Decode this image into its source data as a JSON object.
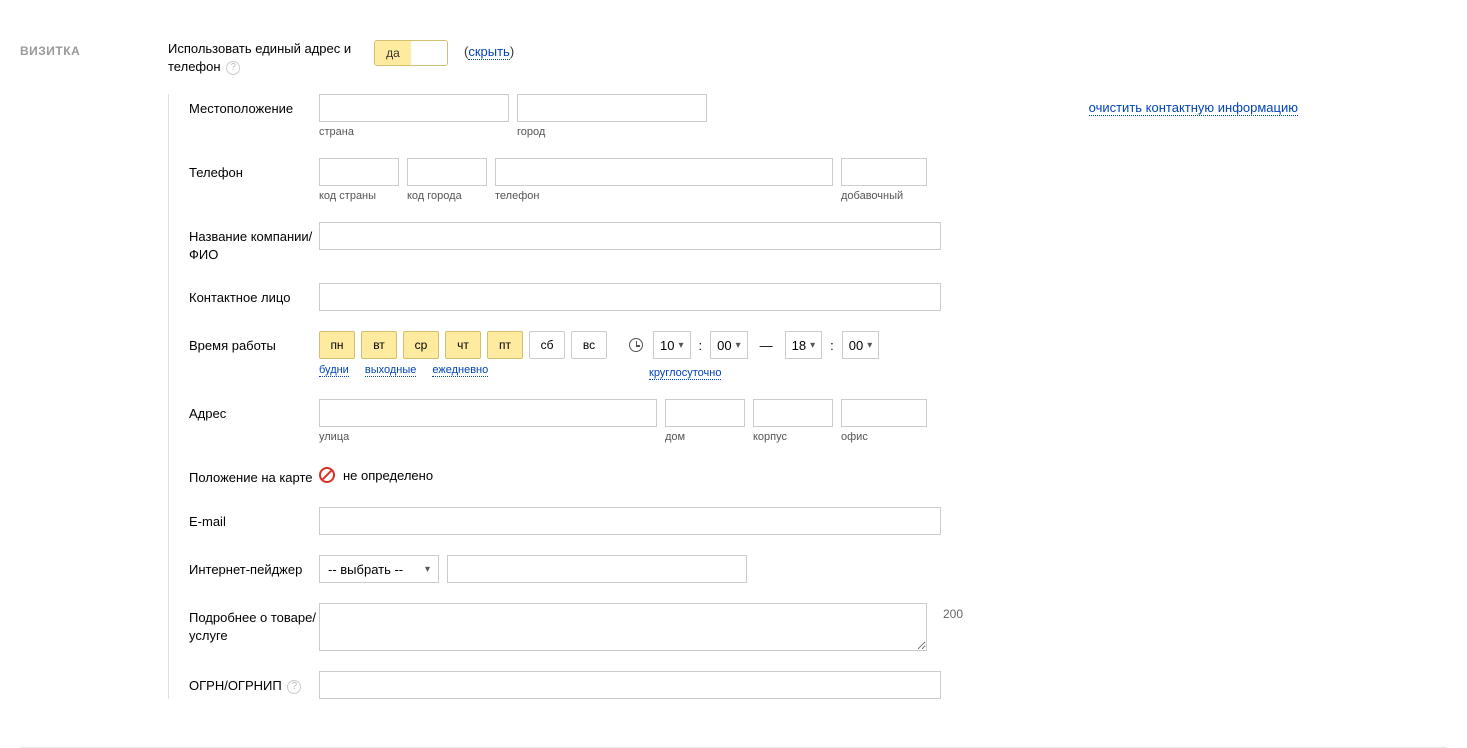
{
  "section_title": "ВИЗИТКА",
  "header": {
    "text": "Использовать единый адрес и телефон",
    "toggle_on": "да",
    "hide_label": "скрыть"
  },
  "clear_link": "очистить контактную информацию",
  "labels": {
    "location": "Местоположение",
    "phone": "Телефон",
    "company": "Название компании/ФИО",
    "contact": "Контактное лицо",
    "hours": "Время работы",
    "address": "Адрес",
    "map_pos": "Положение на карте",
    "email": "E-mail",
    "pager": "Интернет-пейджер",
    "details": "Подробнее о товаре/услуге",
    "ogrn": "ОГРН/ОГРНИП"
  },
  "sublabels": {
    "country": "страна",
    "city": "город",
    "ccode": "код страны",
    "citycode": "код города",
    "phone": "телефон",
    "ext": "добавочный",
    "street": "улица",
    "house": "дом",
    "corpus": "корпус",
    "office": "офис"
  },
  "days": {
    "mon": "пн",
    "tue": "вт",
    "wed": "ср",
    "thu": "чт",
    "fri": "пт",
    "sat": "сб",
    "sun": "вс"
  },
  "quick": {
    "budni": "будни",
    "weekend": "выходные",
    "daily": "ежедневно",
    "around": "круглосуточно"
  },
  "time": {
    "from_h": "10",
    "from_m": "00",
    "to_h": "18",
    "to_m": "00"
  },
  "map_status": "не определено",
  "pager_select": "-- выбрать --",
  "details_counter": "200"
}
